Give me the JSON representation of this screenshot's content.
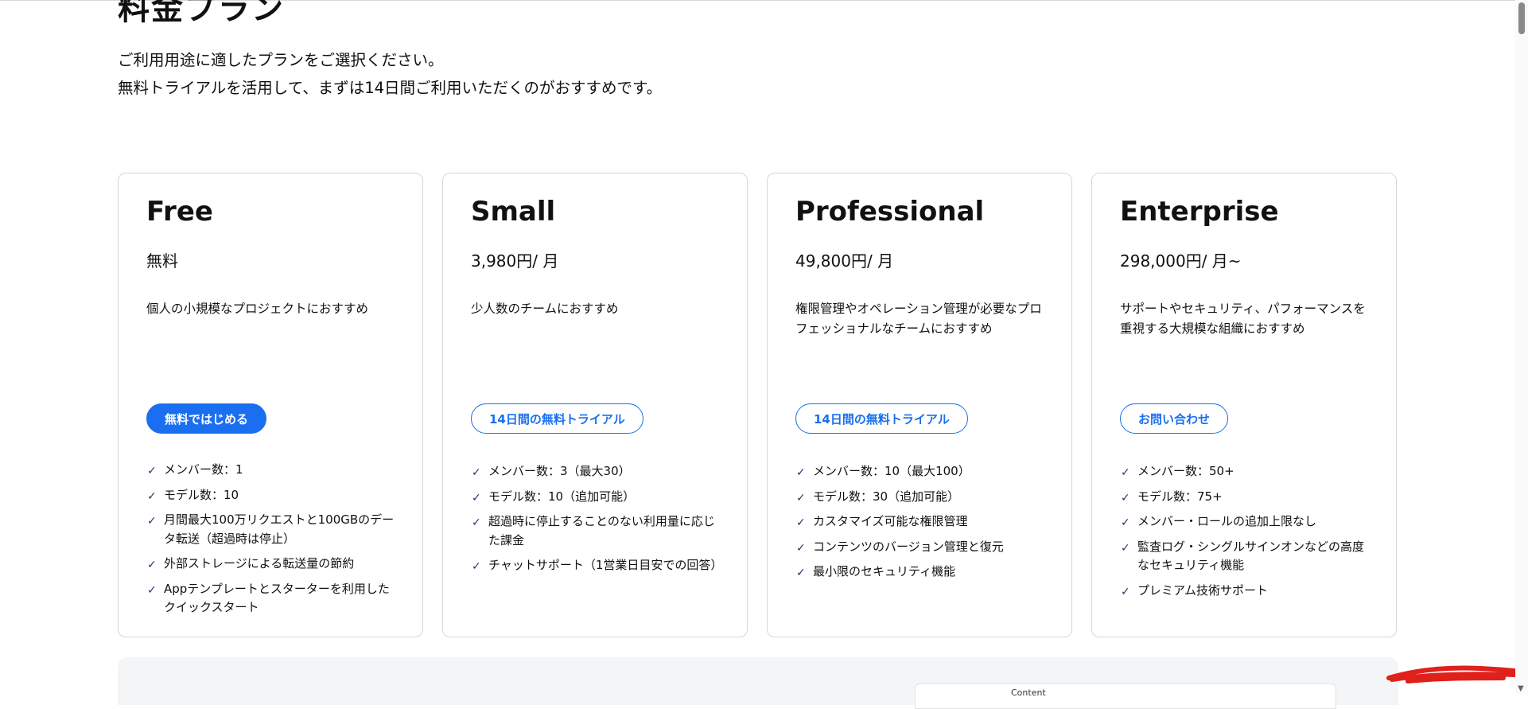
{
  "header": {
    "title": "料金プラン",
    "intro_line1": "ご利用用途に適したプランをご選択ください。",
    "intro_line2": "無料トライアルを活用して、まずは14日間ご利用いただくのがおすすめです。"
  },
  "plans": [
    {
      "name": "Free",
      "price": "無料",
      "description": "個人の小規模なプロジェクトにおすすめ",
      "cta": "無料ではじめる",
      "features": [
        "メンバー数：1",
        "モデル数：10",
        "月間最大100万リクエストと100GBのデータ転送（超過時は停止）",
        "外部ストレージによる転送量の節約",
        "Appテンプレートとスターターを利用したクイックスタート"
      ]
    },
    {
      "name": "Small",
      "price": "3,980円/ 月",
      "description": "少人数のチームにおすすめ",
      "cta": "14日間の無料トライアル",
      "features": [
        "メンバー数：3（最大30）",
        "モデル数：10（追加可能）",
        "超過時に停止することのない利用量に応じた課金",
        "チャットサポート（1営業日目安での回答）"
      ]
    },
    {
      "name": "Professional",
      "price": "49,800円/ 月",
      "description": "権限管理やオペレーション管理が必要なプロフェッショナルなチームにおすすめ",
      "cta": "14日間の無料トライアル",
      "features": [
        "メンバー数：10（最大100）",
        "モデル数：30（追加可能）",
        "カスタマイズ可能な権限管理",
        "コンテンツのバージョン管理と復元",
        "最小限のセキュリティ機能"
      ]
    },
    {
      "name": "Enterprise",
      "price": "298,000円/ 月~",
      "description": "サポートやセキュリティ、パフォーマンスを重視する大規模な組織におすすめ",
      "cta": "お問い合わせ",
      "features": [
        "メンバー数：50+",
        "モデル数：75+",
        "メンバー・ロールの追加上限なし",
        "監査ログ・シングルサインオンなどの高度なセキュリティ機能",
        "プレミアム技術サポート"
      ]
    }
  ],
  "preview": {
    "tab_label": "Content"
  },
  "icons": {
    "check": "check-icon"
  },
  "colors": {
    "accent": "#1a6ff0",
    "check": "#1a3a6e",
    "redaction": "#e0201b"
  }
}
